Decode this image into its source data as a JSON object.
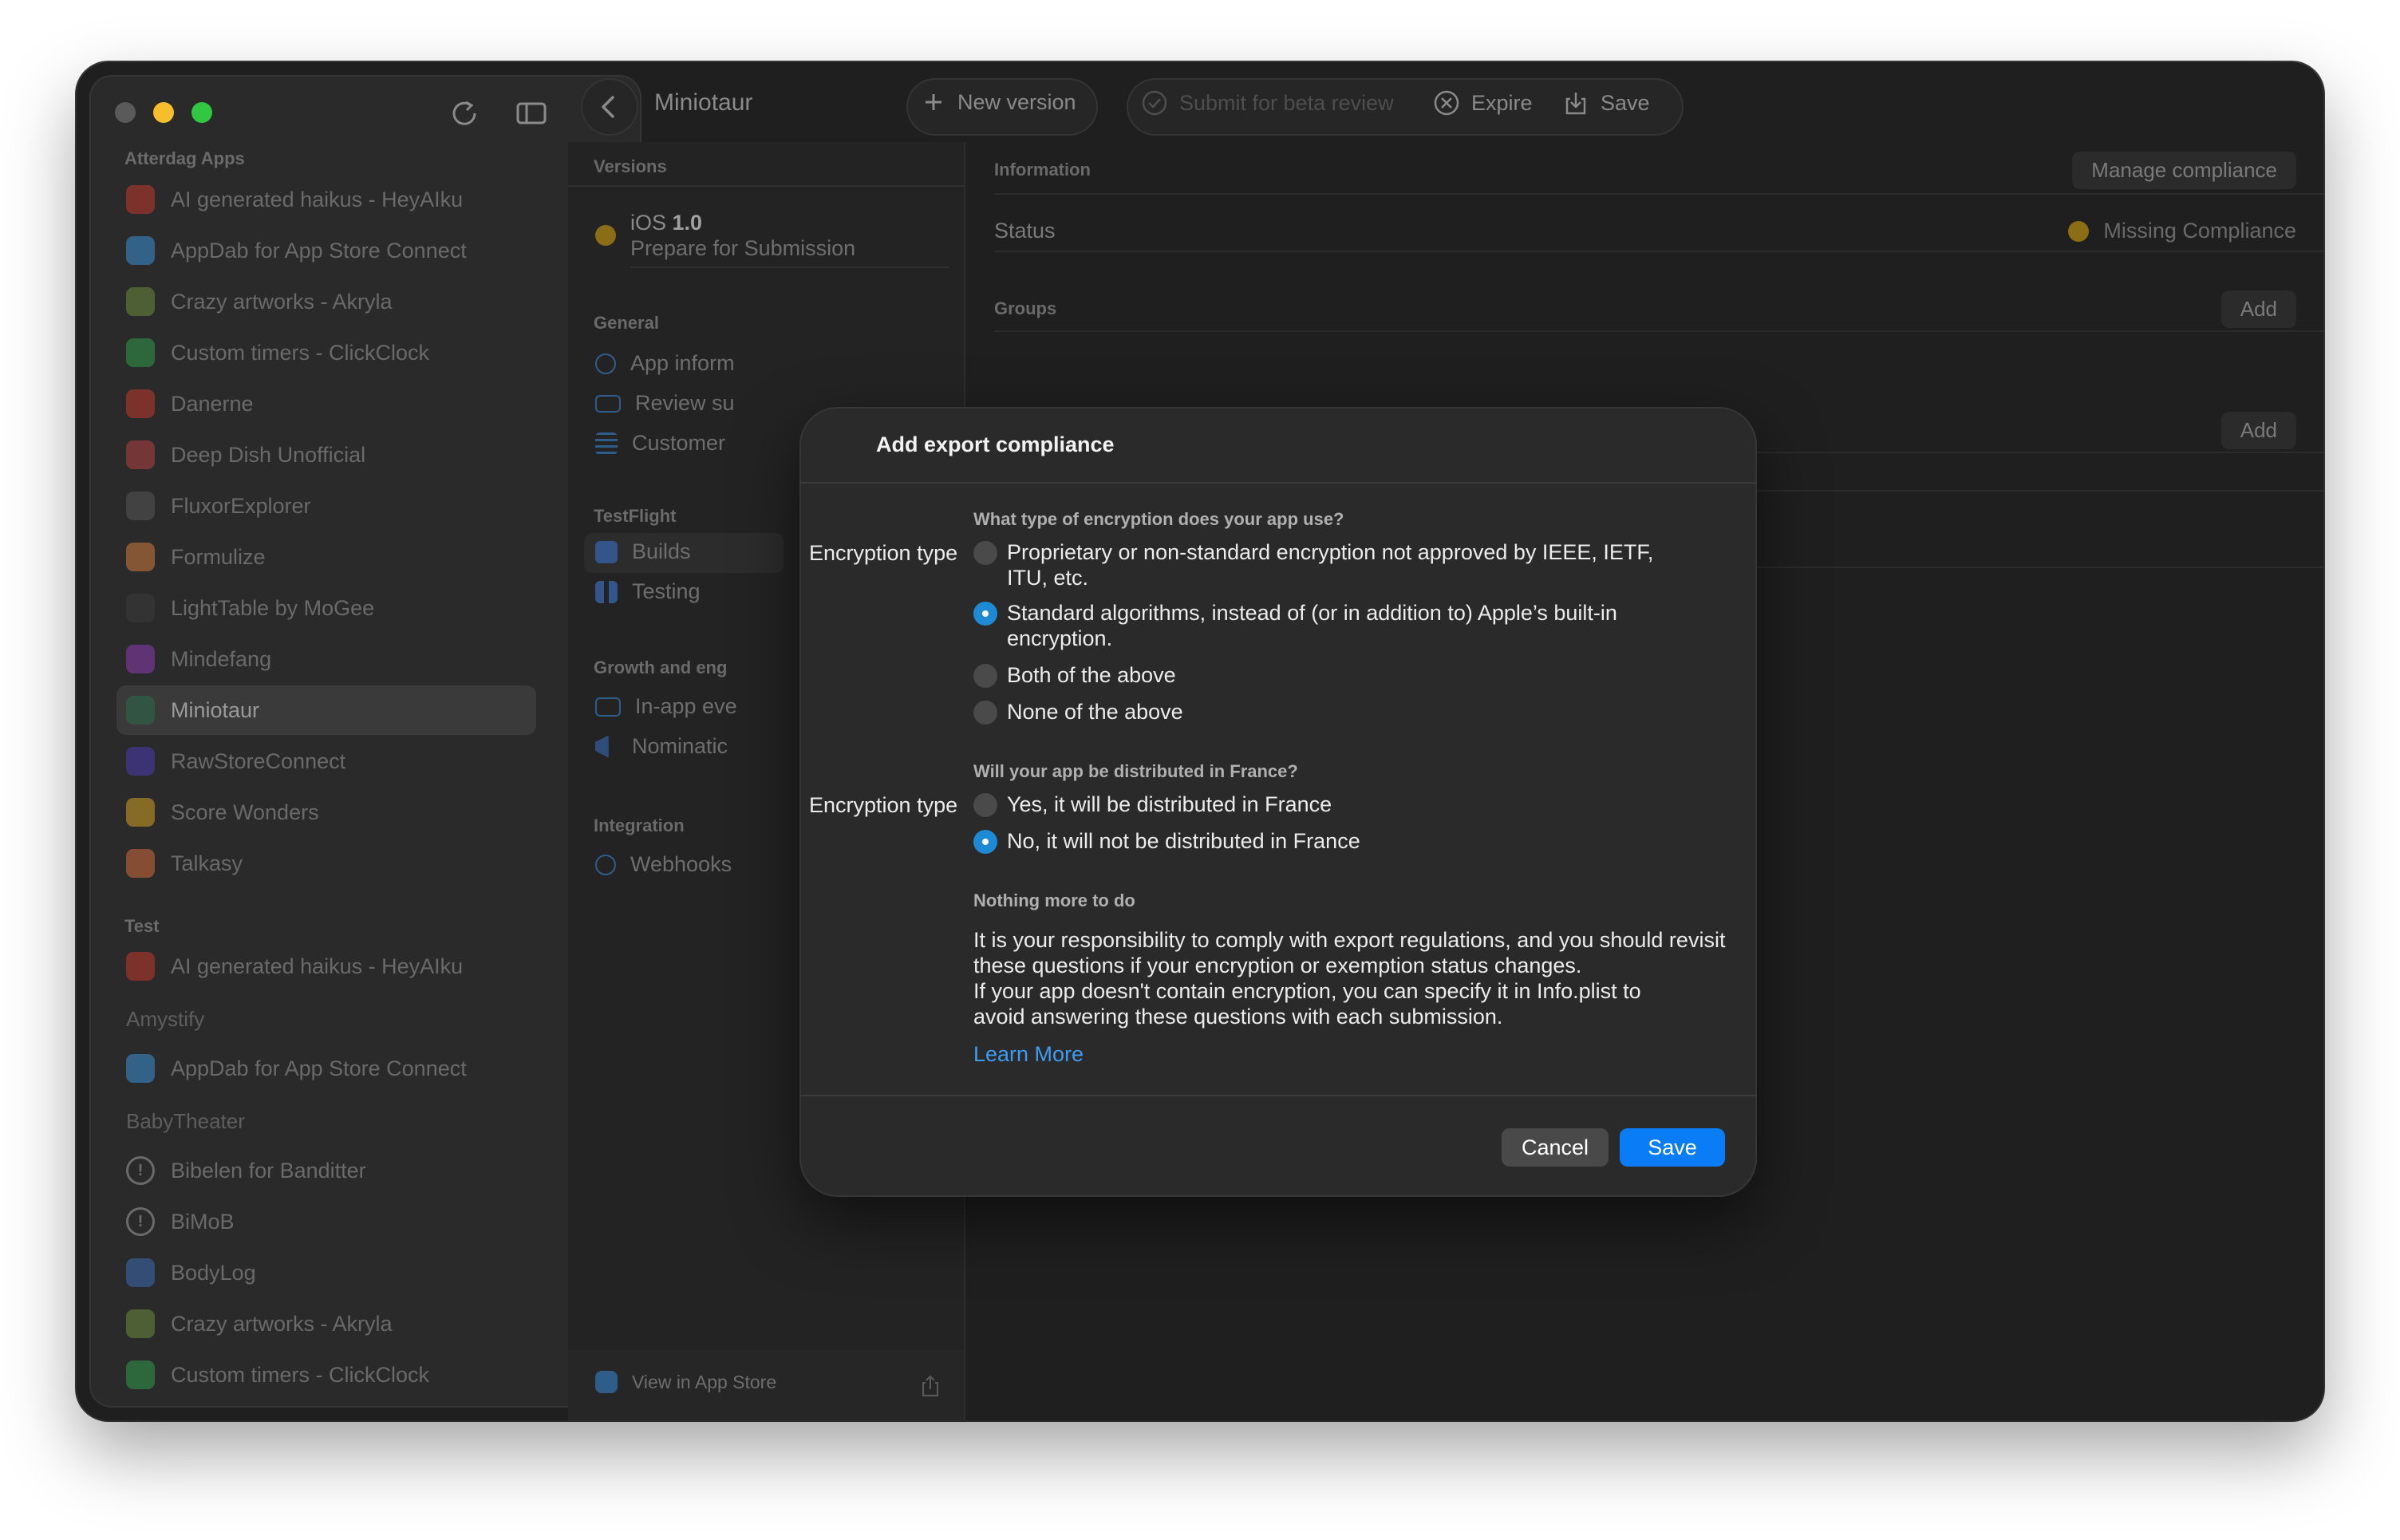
{
  "toolbar": {
    "app_title": "Miniotaur",
    "new_version": "New version",
    "submit_beta": "Submit for beta review",
    "expire": "Expire",
    "save": "Save"
  },
  "sidebar": {
    "section_main": "Atterdag Apps",
    "apps": [
      {
        "label": "AI generated haikus - HeyAIku",
        "color": "#c0392b"
      },
      {
        "label": "AppDab for App Store Connect",
        "color": "#3a8fd6"
      },
      {
        "label": "Crazy artworks - Akryla",
        "color": "#6a8a3a"
      },
      {
        "label": "Custom timers - ClickClock",
        "color": "#2e9a48"
      },
      {
        "label": "Danerne",
        "color": "#c0392b"
      },
      {
        "label": "Deep Dish Unofficial",
        "color": "#b04040"
      },
      {
        "label": "FluxorExplorer",
        "color": "#555555"
      },
      {
        "label": "Formulize",
        "color": "#d07a3a"
      },
      {
        "label": "LightTable by MoGee",
        "color": "#3a3a3a"
      },
      {
        "label": "Mindefang",
        "color": "#8a3ab0"
      },
      {
        "label": "Miniotaur",
        "color": "#2a6a4a"
      },
      {
        "label": "RawStoreConnect",
        "color": "#4a3ab0"
      },
      {
        "label": "Score Wonders",
        "color": "#d0a020"
      },
      {
        "label": "Talkasy",
        "color": "#d06a3a"
      }
    ],
    "section_test": "Test",
    "test_items": [
      {
        "label": "AI generated haikus - HeyAIku",
        "color": "#c0392b"
      }
    ],
    "group_amystify": "Amystify",
    "amystify_items": [
      {
        "label": "AppDab for App Store Connect",
        "color": "#3a8fd6"
      }
    ],
    "group_babytheater": "BabyTheater",
    "babytheater_items": [
      {
        "label": "Bibelen for Banditter",
        "icon": "warning"
      },
      {
        "label": "BiMoB",
        "icon": "warning"
      },
      {
        "label": "BodyLog",
        "color": "#3a6ab0"
      },
      {
        "label": "Crazy artworks - Akryla",
        "color": "#6a8a3a"
      },
      {
        "label": "Custom timers - ClickClock",
        "color": "#2e9a48"
      }
    ]
  },
  "versions": {
    "header": "Versions",
    "platform": "iOS",
    "number": "1.0",
    "state": "Prepare for Submission",
    "general_header": "General",
    "general_items": [
      "App inform",
      "Review su",
      "Customer"
    ],
    "testflight_header": "TestFlight",
    "testflight_items": [
      "Builds",
      "Testing"
    ],
    "growth_header": "Growth and eng",
    "growth_items": [
      "In-app eve",
      "Nominatic"
    ],
    "integration_header": "Integration",
    "integration_items": [
      "Webhooks"
    ],
    "footer_link": "View in App Store"
  },
  "detail": {
    "information_header": "Information",
    "manage_compliance": "Manage compliance",
    "status_label": "Status",
    "status_value": "Missing Compliance",
    "groups_header": "Groups",
    "add_label_1": "Add",
    "add_label_2": "Add"
  },
  "modal": {
    "title": "Add export compliance",
    "q1": "What type of encryption does your app use?",
    "q1_label": "Encryption type",
    "q1_options": [
      {
        "text": "Proprietary or non-standard encryption not approved by IEEE, IETF, ITU, etc.",
        "checked": false
      },
      {
        "text": "Standard algorithms, instead of (or in addition to) Apple’s built-in encryption.",
        "checked": true
      },
      {
        "text": "Both of the above",
        "checked": false
      },
      {
        "text": "None of the above",
        "checked": false
      }
    ],
    "q2": "Will your app be distributed in France?",
    "q2_label": "Encryption type",
    "q2_options": [
      {
        "text": "Yes, it will be distributed in France",
        "checked": false
      },
      {
        "text": "No, it will not be distributed in France",
        "checked": true
      }
    ],
    "note_title": "Nothing more to do",
    "note_p1": "It is your responsibility to comply with export regulations, and you should revisit these questions if your encryption or exemption status changes.",
    "note_p2": "If your app doesn't contain encryption, you can specify it in Info.plist to avoid answering these questions with each submission.",
    "learn_more": "Learn More",
    "cancel": "Cancel",
    "save": "Save"
  }
}
